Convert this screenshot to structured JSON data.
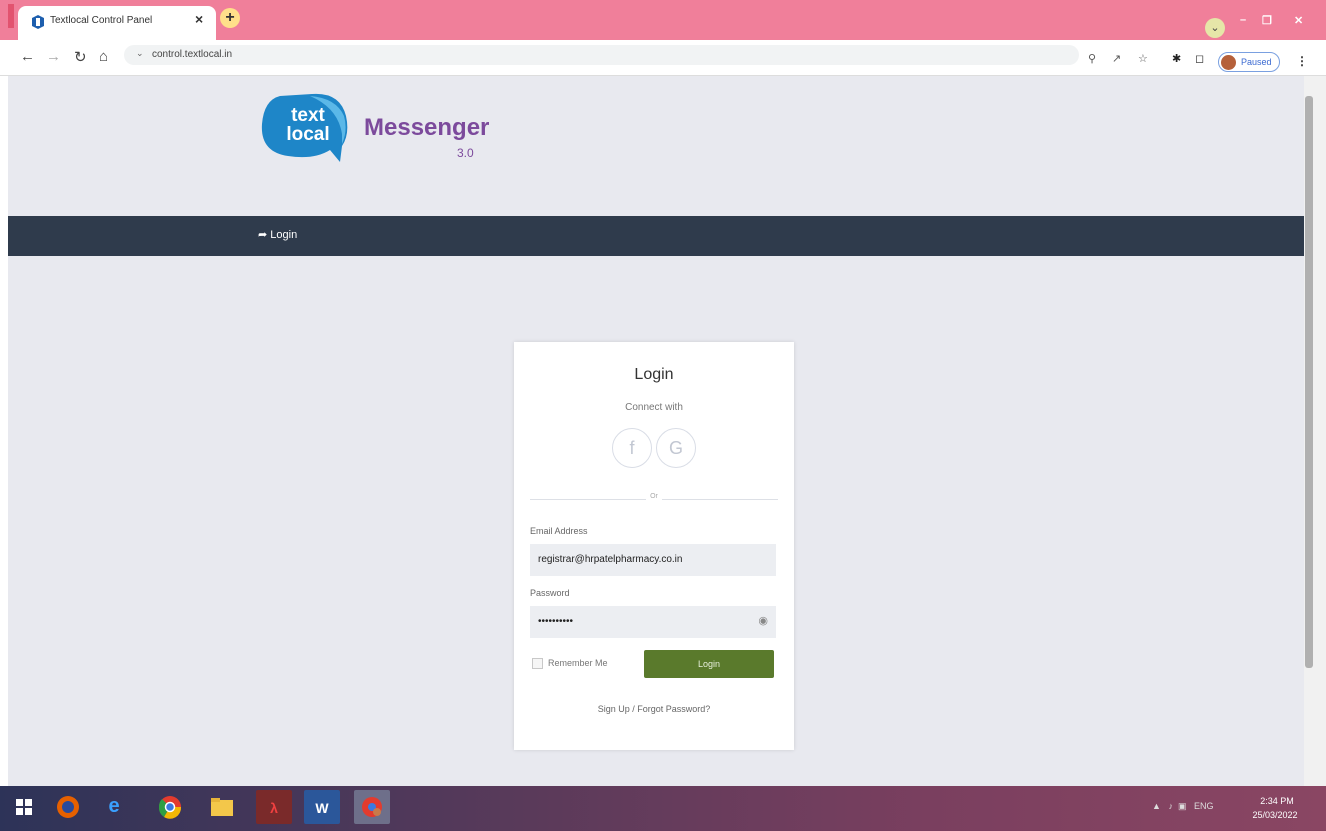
{
  "browser": {
    "tab_title": "Textlocal Control Panel",
    "tab_close": "×",
    "new_tab": "+",
    "url": "control.textlocal.in",
    "profile_label": "Paused"
  },
  "brand": {
    "logo_line1": "text",
    "logo_line2": "local",
    "name": "Messenger",
    "version": "3.0"
  },
  "nav": {
    "login_label": "Login"
  },
  "login": {
    "title": "Login",
    "connect_with": "Connect with",
    "facebook_glyph": "f",
    "google_glyph": "G",
    "or_label": "Or",
    "email_label": "Email Address",
    "email_value": "registrar@hrpatelpharmacy.co.in",
    "password_label": "Password",
    "password_value": "••••••••••",
    "remember_label": "Remember Me",
    "button_label": "Login",
    "signup_link": "Sign Up / Forgot Password?"
  },
  "taskbar": {
    "tray_lang": "ENG",
    "time": "2:34 PM",
    "date": "25/03/2022"
  },
  "colors": {
    "tabstrip": "#f07f9a",
    "navbar": "#2f3b4c",
    "brand": "#7c4a9c",
    "logo_blue": "#1e86c8",
    "login_button": "#5a7a2c"
  }
}
